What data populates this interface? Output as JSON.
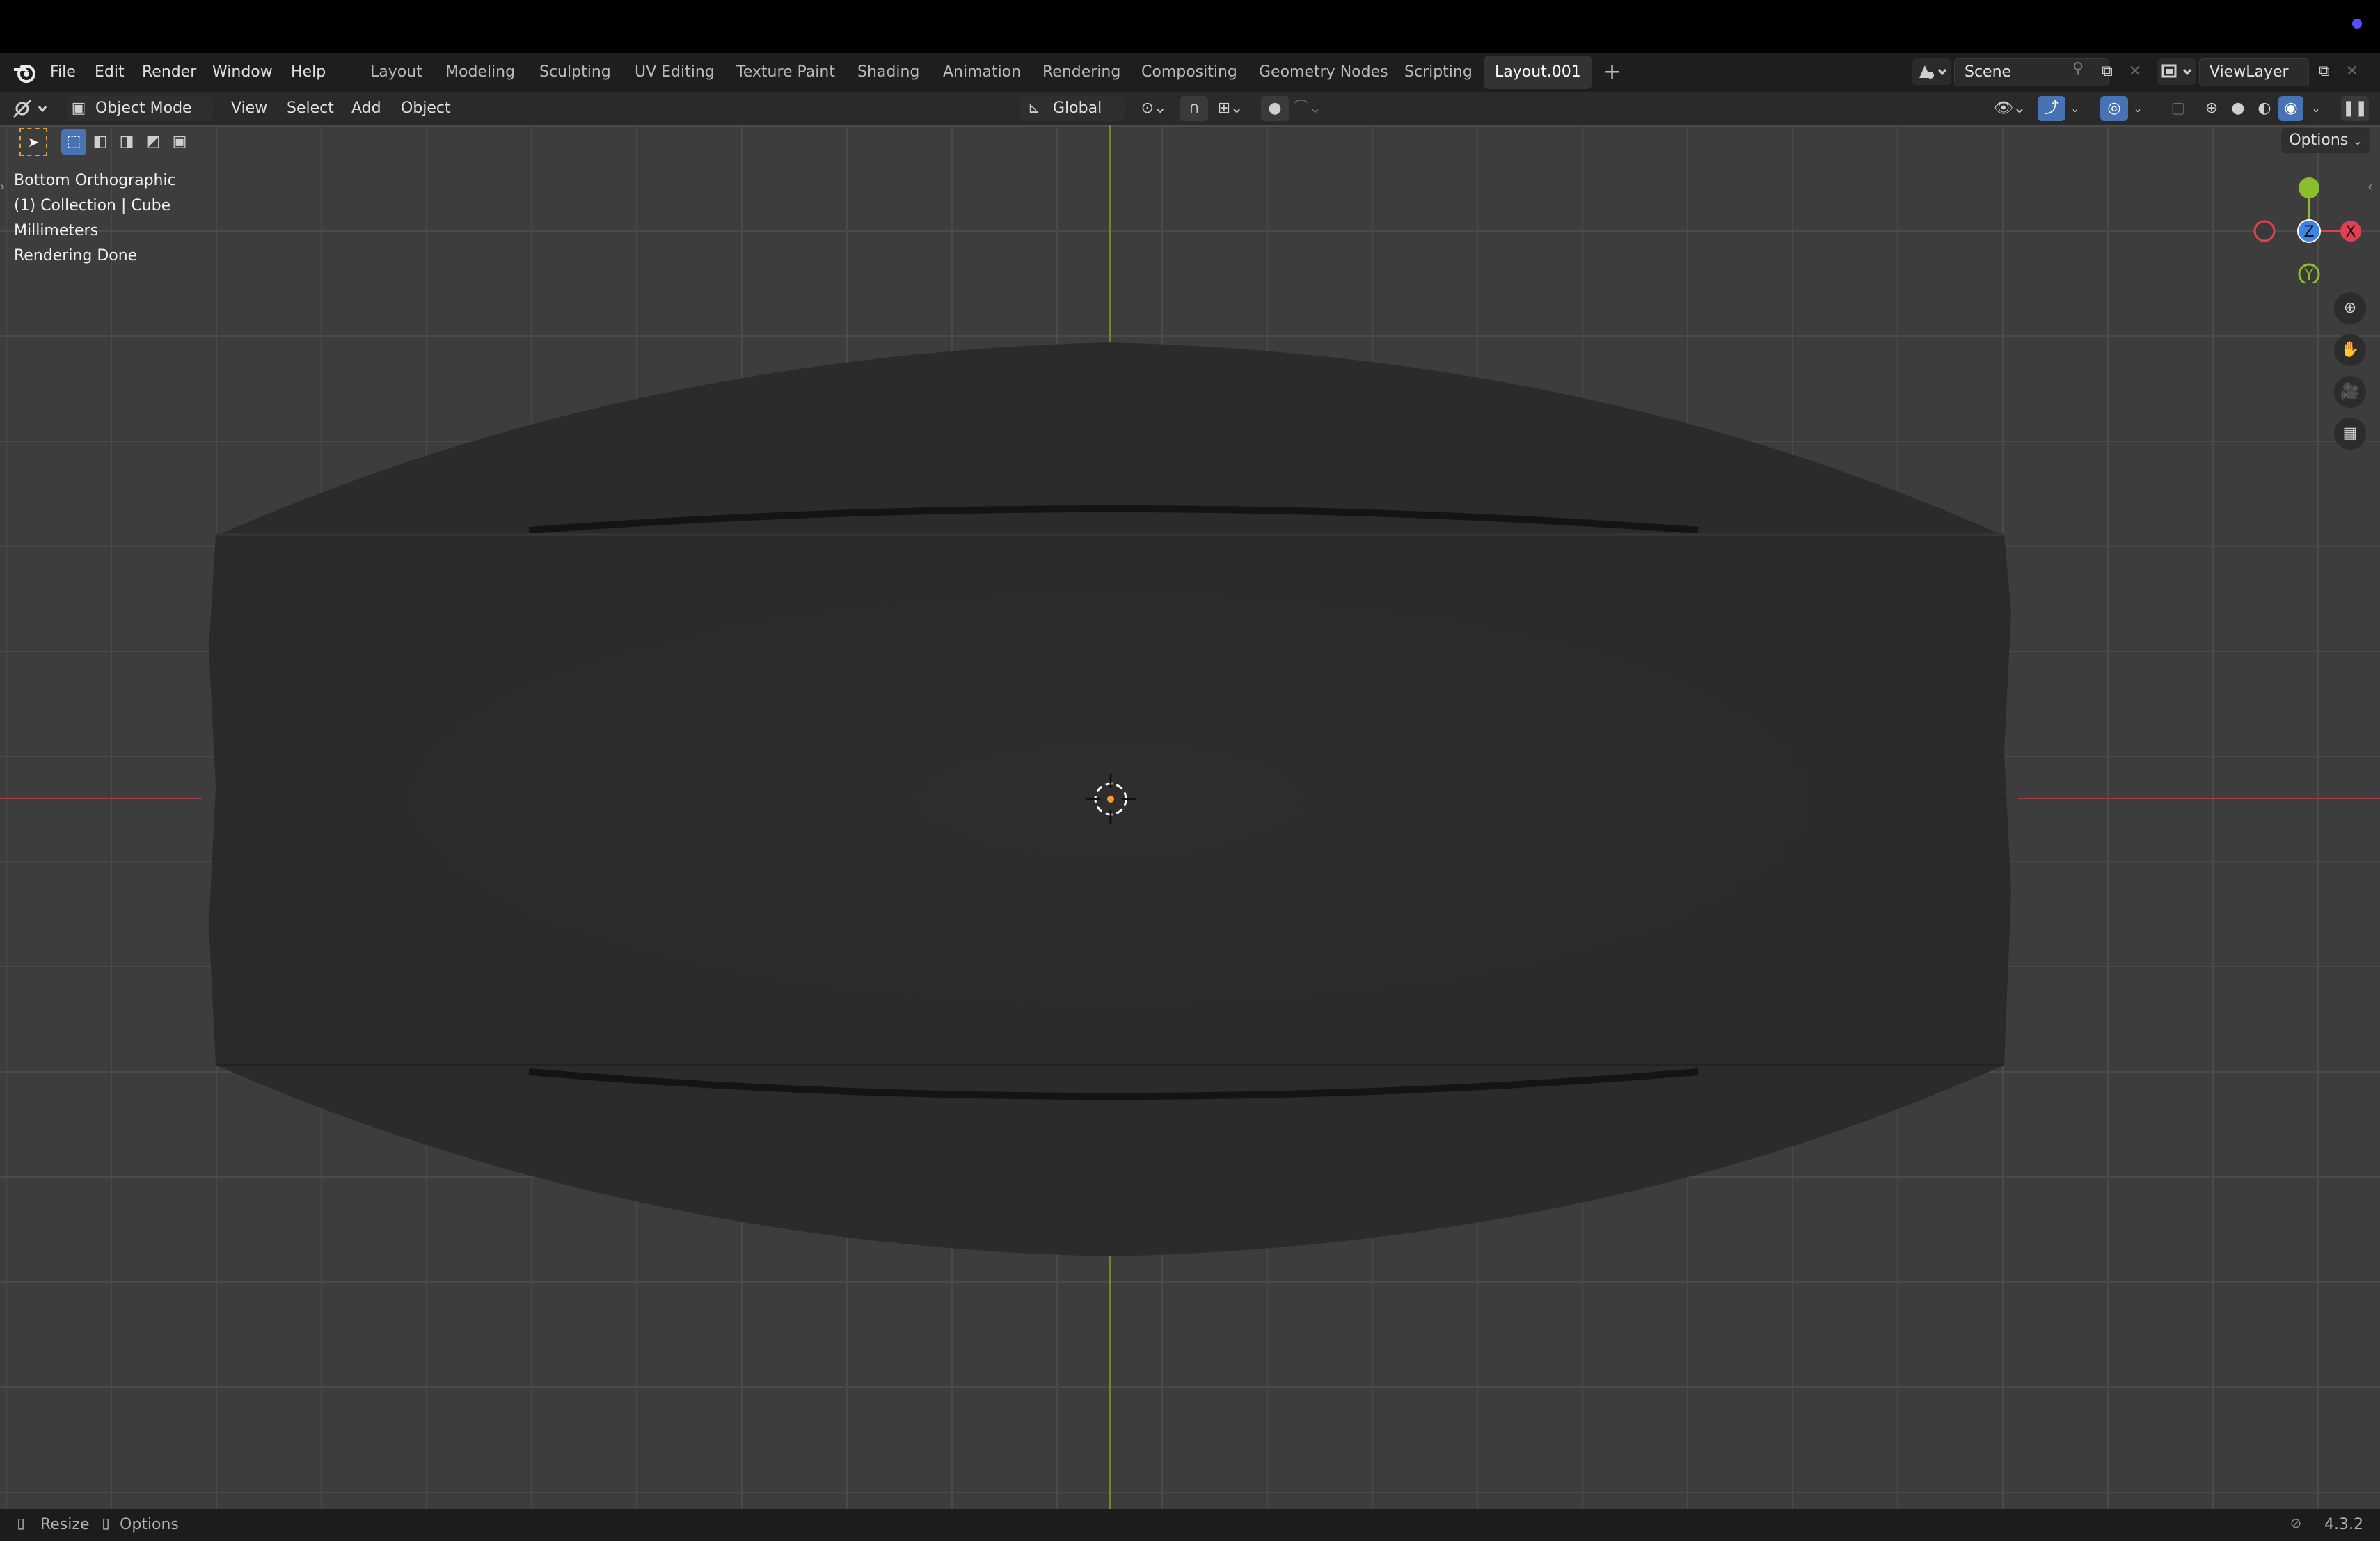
{
  "menus": [
    "File",
    "Edit",
    "Render",
    "Window",
    "Help"
  ],
  "workspaces": [
    "Layout",
    "Modeling",
    "Sculpting",
    "UV Editing",
    "Texture Paint",
    "Shading",
    "Animation",
    "Rendering",
    "Compositing",
    "Geometry Nodes",
    "Scripting",
    "Layout.001"
  ],
  "active_workspace": "Layout.001",
  "add_workspace_label": "+",
  "scene": {
    "name": "Scene"
  },
  "view_layer": {
    "name": "ViewLayer"
  },
  "header": {
    "mode": "Object Mode",
    "menus": [
      "View",
      "Select",
      "Add",
      "Object"
    ],
    "orientation": "Global",
    "options_label": "Options"
  },
  "overlay": {
    "view_name": "Bottom Orthographic",
    "collection": "(1) Collection | Cube",
    "units": "Millimeters",
    "render_status": "Rendering Done"
  },
  "gizmo": {
    "axes": [
      "Y",
      "Z",
      "X"
    ],
    "colors": {
      "x": "#e04050",
      "y": "#8bbd2c",
      "z": "#3d84e6"
    }
  },
  "status_bar": {
    "left": [
      {
        "icon": "mouse-left-icon",
        "label": "Resize"
      },
      {
        "icon": "mouse-right-icon",
        "label": "Options"
      }
    ],
    "version": "4.3.2"
  },
  "colors": {
    "accent": "#4772b3",
    "axis_x": "#a83845",
    "axis_y": "#6b8b22",
    "background": "#3d3d3d"
  }
}
